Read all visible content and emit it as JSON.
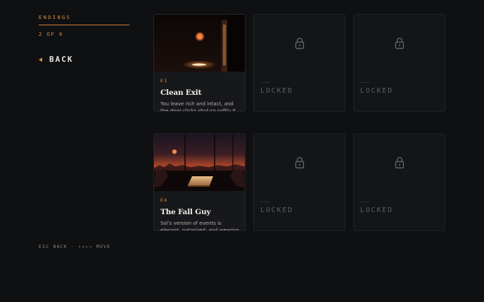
{
  "sidebar": {
    "heading": "ENDINGS",
    "progress": "2 OF 6",
    "back_label": "BACK",
    "hint": "ESC BACK · ↑↓←→ MOVE"
  },
  "endings": [
    {
      "code": "E1",
      "title": "Clean Exit",
      "description": "You leave rich and intact, and the door clicks shut so softly it scares you.",
      "unlocked": true
    },
    {
      "code": "———",
      "label": "LOCKED",
      "unlocked": false
    },
    {
      "code": "———",
      "label": "LOCKED",
      "unlocked": false
    },
    {
      "code": "E4",
      "title": "The Fall Guy",
      "description": "Sol's version of events is elegant, notarized, and wearing your name.",
      "unlocked": true
    },
    {
      "code": "———",
      "label": "LOCKED",
      "unlocked": false
    },
    {
      "code": "———",
      "label": "LOCKED",
      "unlocked": false
    }
  ],
  "colors": {
    "accent": "#e0913c",
    "background": "#0f1012",
    "card": "#17181b"
  },
  "icons": {
    "back": "triangle-left-icon",
    "locked": "padlock-icon"
  }
}
